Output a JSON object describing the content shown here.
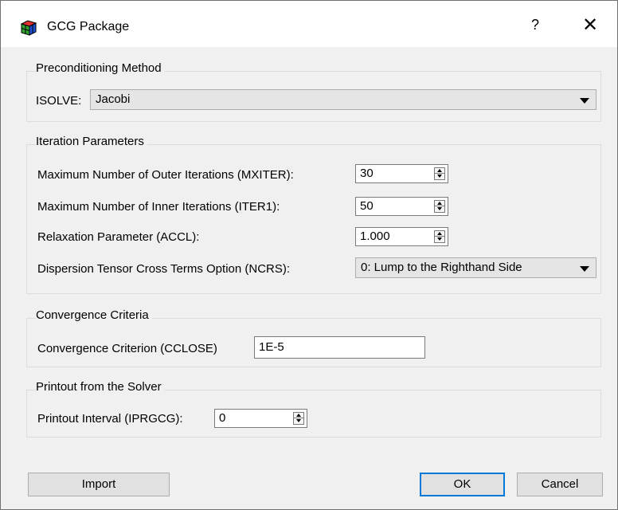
{
  "window": {
    "title": "GCG Package",
    "help_label": "?",
    "close_label": "✕"
  },
  "preconditioning": {
    "title": "Preconditioning Method",
    "isolve_label": "ISOLVE:",
    "isolve_value": "Jacobi"
  },
  "iteration": {
    "title": "Iteration Parameters",
    "mxiter_label": "Maximum Number of Outer Iterations (MXITER):",
    "mxiter_value": "30",
    "iter1_label": "Maximum Number of Inner Iterations (ITER1):",
    "iter1_value": "50",
    "accl_label": "Relaxation Parameter (ACCL):",
    "accl_value": "1.000",
    "ncrs_label": "Dispersion Tensor Cross Terms Option (NCRS):",
    "ncrs_value": "0: Lump to the Righthand Side"
  },
  "convergence": {
    "title": "Convergence Criteria",
    "cclose_label": "Convergence Criterion (CCLOSE)",
    "cclose_value": "1E-5"
  },
  "printout": {
    "title": "Printout from the Solver",
    "iprgcg_label": "Printout Interval (IPRGCG):",
    "iprgcg_value": "0"
  },
  "buttons": {
    "import": "Import",
    "ok": "OK",
    "cancel": "Cancel"
  },
  "colors": {
    "accent": "#0078d7",
    "dialog_bg": "#f0f0f0"
  }
}
